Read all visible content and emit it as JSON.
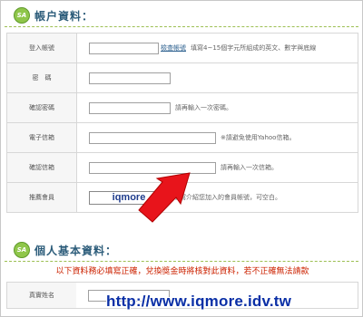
{
  "sections": [
    {
      "icon_label": "SA",
      "title": "帳户資料："
    },
    {
      "icon_label": "SA",
      "title": "個人基本資料："
    }
  ],
  "account_rows": [
    {
      "label": "登入帳號",
      "value": "",
      "button": "檢查帳號",
      "hint": "填寫4~15個字元所組成的英文、數字與底線"
    },
    {
      "label": "密　碼",
      "value": ""
    },
    {
      "label": "確認密碼",
      "value": "",
      "hint": "請再輸入一次密碼。"
    },
    {
      "label": "電子信箱",
      "value": "",
      "hint": "※請避免使用Yahoo信箱。"
    },
    {
      "label": "確認信箱",
      "value": "",
      "hint": "請再輸入一次信箱。"
    },
    {
      "label": "推薦會員",
      "value": "iqmore",
      "hint": "填寫介紹您加入的會員帳號，可空白。"
    }
  ],
  "notice": "以下資料務必填寫正確，兌換獎金時將核對此資料，若不正確無法請款",
  "personal_rows": [
    {
      "label": "真實姓名",
      "value": ""
    }
  ],
  "watermark": "http://www.iqmore.idv.tw",
  "colors": {
    "section_title": "#2c5c7a",
    "icon_green": "#8fc64a",
    "notice_red": "#cc2200",
    "arrow_red": "#e8141b",
    "watermark_blue": "#0a2fa6"
  }
}
